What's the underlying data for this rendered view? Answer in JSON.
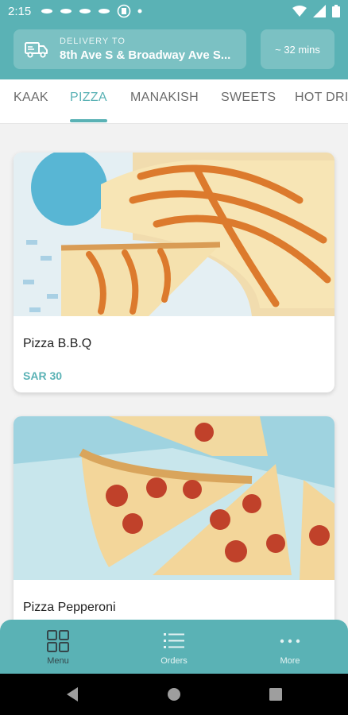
{
  "status_bar": {
    "time": "2:15"
  },
  "header": {
    "delivery_label": "DELIVERY TO",
    "delivery_address": "8th Ave S & Broadway Ave S...",
    "eta": "~ 32 mins"
  },
  "tabs": [
    {
      "label": "KAAK"
    },
    {
      "label": "PIZZA"
    },
    {
      "label": "MANAKISH"
    },
    {
      "label": "SWEETS"
    },
    {
      "label": "HOT DRI"
    }
  ],
  "active_tab": "PIZZA",
  "products": [
    {
      "name": "Pizza B.B.Q",
      "price": "SAR 30"
    },
    {
      "name": "Pizza Pepperoni"
    }
  ],
  "bottom_nav": [
    {
      "label": "Menu",
      "icon": "grid-icon"
    },
    {
      "label": "Orders",
      "icon": "list-icon"
    },
    {
      "label": "More",
      "icon": "more-dots-icon"
    }
  ],
  "colors": {
    "accent": "#5ab2b5",
    "price": "#5ab2b5",
    "active_nav_label": "#35464a"
  }
}
